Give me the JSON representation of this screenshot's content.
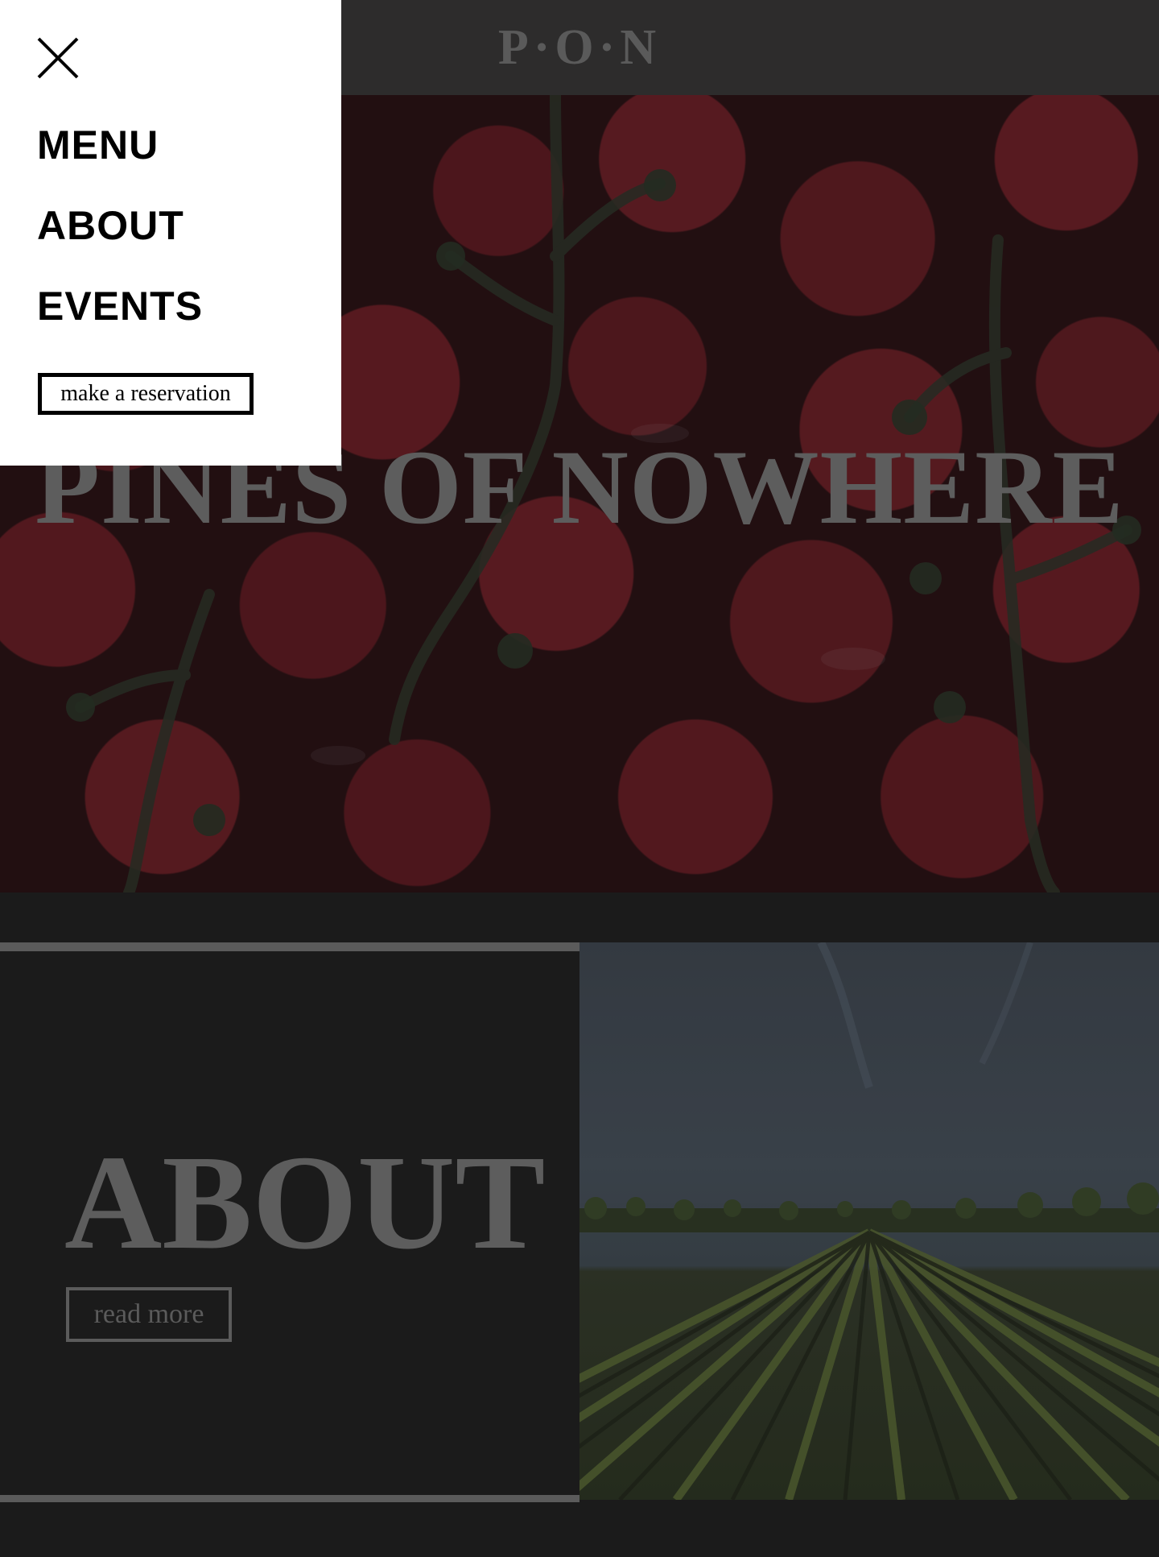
{
  "header": {
    "logo_text": "P·O·N"
  },
  "hero": {
    "title": "PINES OF NOWHERE"
  },
  "about": {
    "title": "ABOUT",
    "read_more_label": "read more"
  },
  "drawer": {
    "close_icon": "close-icon",
    "nav_items": [
      {
        "label": "MENU"
      },
      {
        "label": "ABOUT"
      },
      {
        "label": "EVENTS"
      }
    ],
    "reservation_label": "make a reservation"
  },
  "colors": {
    "page_background": "#1b1b1b",
    "header_background": "#2d2c2c",
    "muted_text": "#5d5d5d",
    "drawer_background": "#ffffff",
    "drawer_text": "#000000"
  }
}
